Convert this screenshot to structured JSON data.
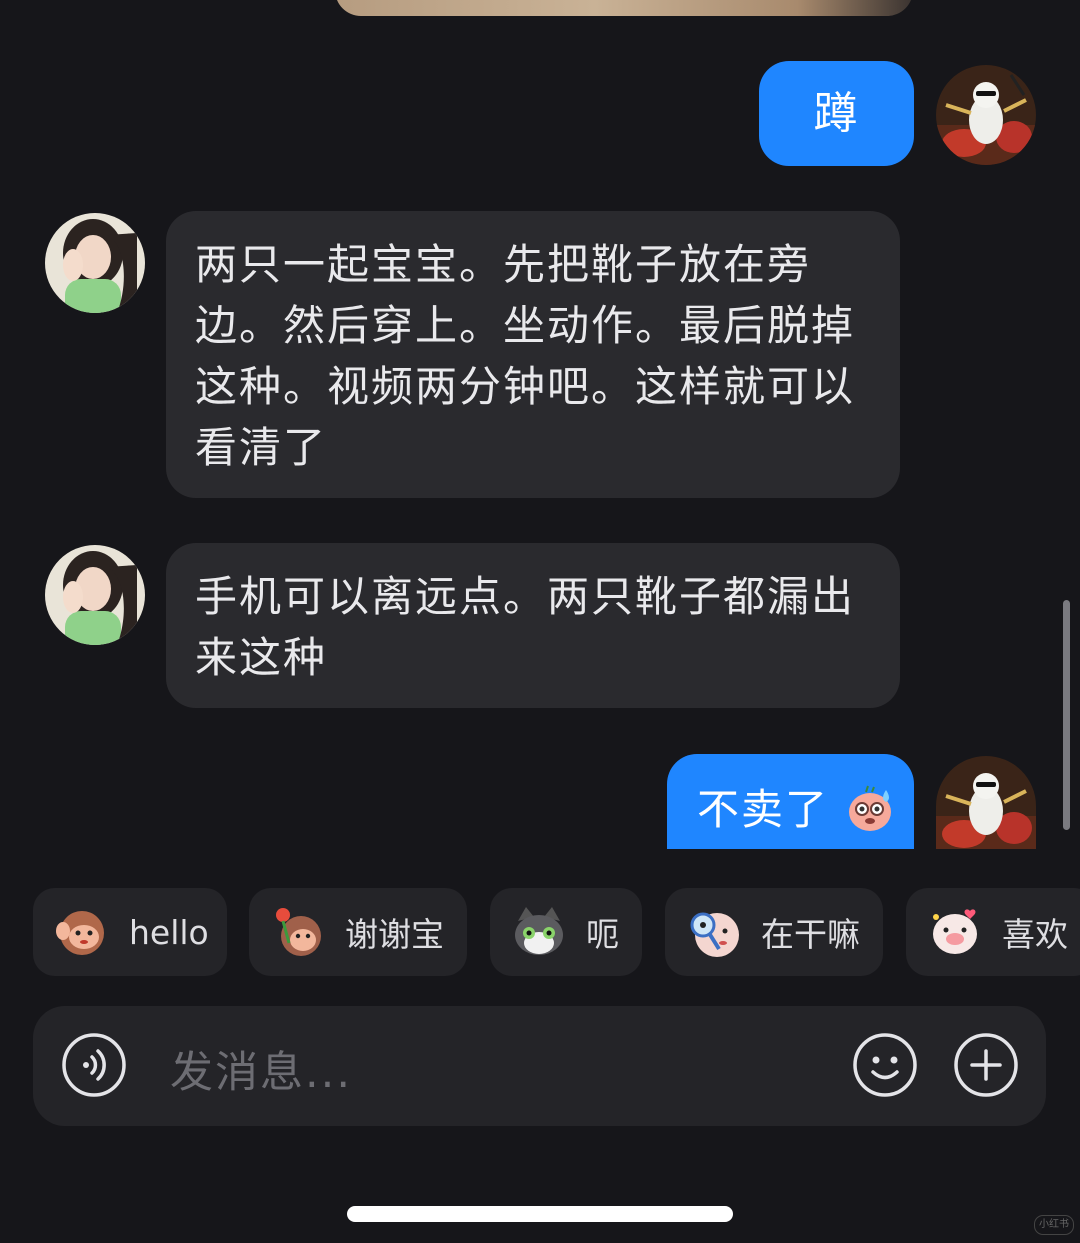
{
  "conversation": {
    "messages": [
      {
        "side": "out",
        "text": "蹲"
      },
      {
        "side": "in",
        "lines": [
          "两只一起宝宝。先把靴子放在旁",
          "边。然后穿上。坐动作。最后脱掉",
          "这种。视频两分钟吧。这样就可以",
          "看清了"
        ]
      },
      {
        "side": "in",
        "lines": [
          "手机可以离远点。两只靴子都漏出",
          "来这种"
        ]
      },
      {
        "side": "out",
        "text": "不卖了"
      }
    ]
  },
  "quick_replies": [
    {
      "label": "hello",
      "icon": "monkey-wave-icon"
    },
    {
      "label": "谢谢宝",
      "icon": "monkey-flower-icon"
    },
    {
      "label": "呃",
      "icon": "cat-face-icon"
    },
    {
      "label": "在干嘛",
      "icon": "magnifier-peek-icon"
    },
    {
      "label": "喜欢",
      "icon": "pig-love-icon"
    }
  ],
  "composer": {
    "placeholder": "发消息...",
    "voice_icon": "voice-icon",
    "emoji_icon": "emoji-icon",
    "plus_icon": "plus-icon"
  },
  "colors": {
    "background": "#16161a",
    "incoming_bubble": "#2a2a2e",
    "outgoing_bubble": "#1f86ff"
  },
  "watermark": "小红书"
}
